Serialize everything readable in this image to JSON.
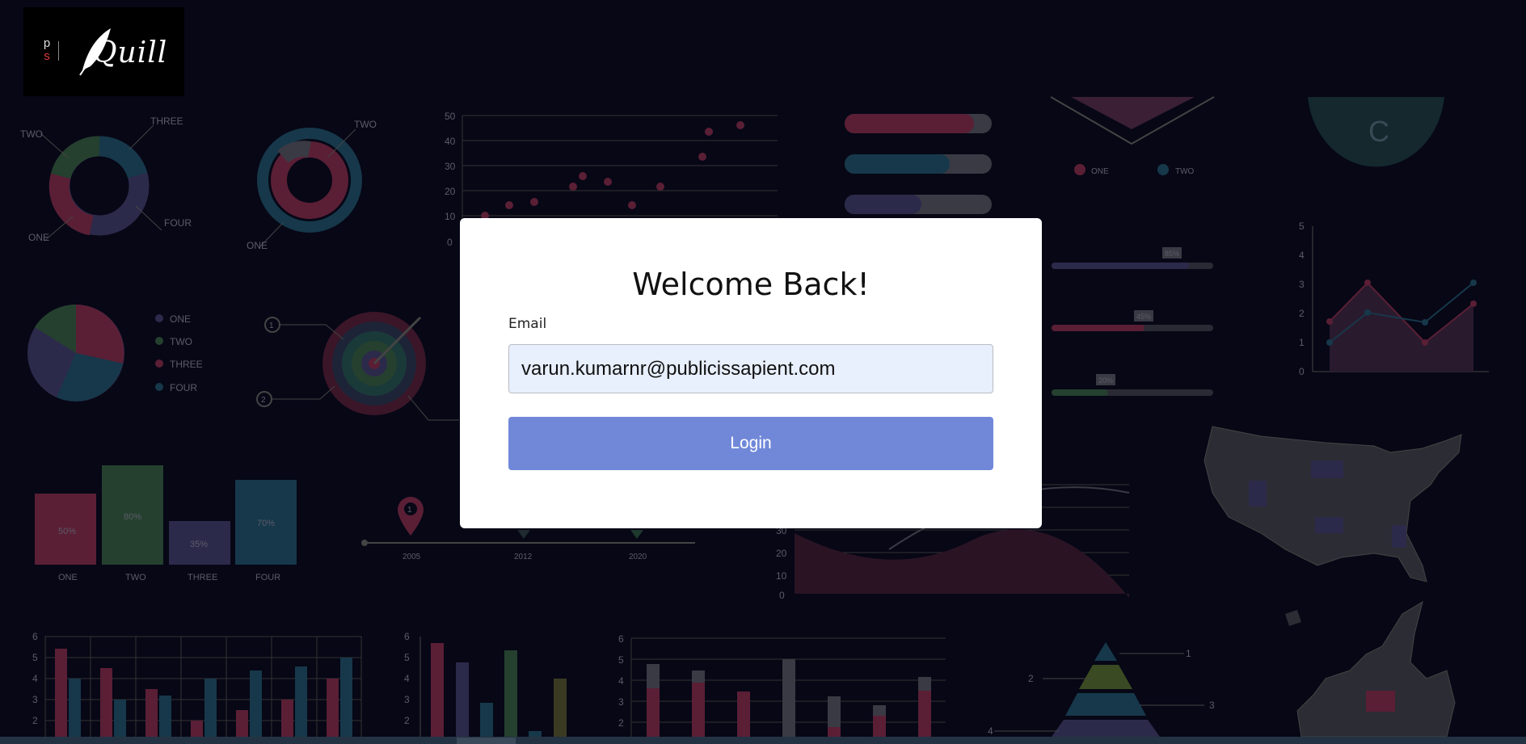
{
  "brand": {
    "mark_top": "p",
    "mark_bottom": "s",
    "name": "Quill"
  },
  "modal": {
    "title": "Welcome Back!",
    "email_label": "Email",
    "email_value": "varun.kumarnr@publicissapient.com",
    "login_label": "Login"
  },
  "background": {
    "donut1": [
      "TWO",
      "THREE",
      "ONE",
      "FOUR"
    ],
    "donut2": [
      "TWO",
      "ONE"
    ],
    "scatter_y_ticks": [
      "50",
      "40",
      "30",
      "20",
      "10",
      "0"
    ],
    "legend_a": [
      "ONE",
      "TWO"
    ],
    "semi_letter": "C",
    "pie_legend": [
      "ONE",
      "TWO",
      "THREE",
      "FOUR"
    ],
    "target_markers": [
      "1",
      "2"
    ],
    "bars": [
      {
        "label": "ONE",
        "value": "50%"
      },
      {
        "label": "TWO",
        "value": "80%"
      },
      {
        "label": "THREE",
        "value": "35%"
      },
      {
        "label": "FOUR",
        "value": "70%"
      }
    ],
    "timeline": [
      "2005",
      "2012",
      "2020"
    ],
    "timeline_pin": "1",
    "slider_badges": [
      "85%",
      "45%",
      "20%"
    ],
    "area_y_ticks": [
      "30",
      "20",
      "10",
      "0"
    ],
    "line_y_ticks": [
      "5",
      "4",
      "3",
      "2",
      "1",
      "0"
    ],
    "bottom_y_ticks": [
      "6",
      "5",
      "4",
      "3",
      "2"
    ],
    "pyramid_labels": [
      "1",
      "2",
      "3",
      "4"
    ],
    "colors": {
      "red": "#5a1f35",
      "green": "#25402f",
      "teal": "#16384a",
      "purple": "#2c2a4a",
      "grey": "#3a3a44"
    }
  }
}
